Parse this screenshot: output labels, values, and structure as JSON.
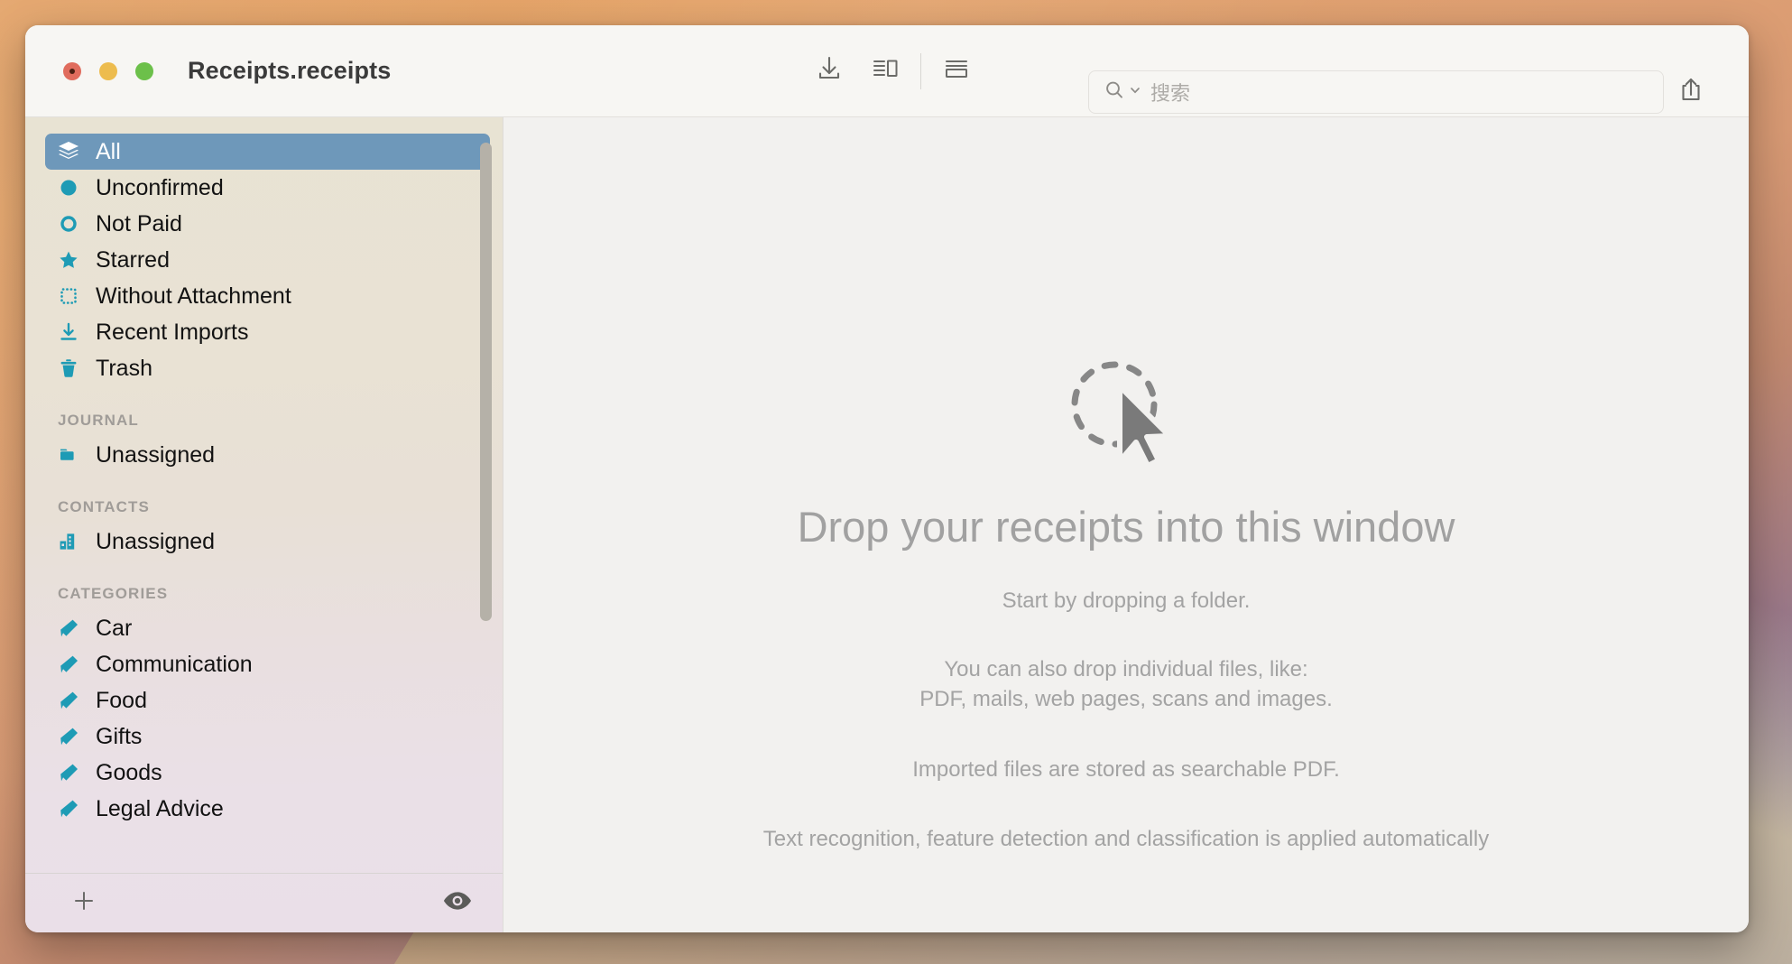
{
  "window": {
    "title": "Receipts.receipts",
    "traffic_lights": [
      "close",
      "minimize",
      "zoom"
    ]
  },
  "toolbar": {
    "import_icon": "download-icon",
    "sidebar_toggle_icon": "sidebar-split-view-icon",
    "list_view_icon": "list-view-icon",
    "share_icon": "share-icon",
    "search": {
      "icon": "search-icon",
      "chevron": "chevron-down-icon",
      "value": "",
      "placeholder": "搜索"
    }
  },
  "sidebar": {
    "smart_groups": [
      {
        "label": "All",
        "icon": "layers-stack-icon",
        "selected": true
      },
      {
        "label": "Unconfirmed",
        "icon": "filled-circle-icon",
        "selected": false
      },
      {
        "label": "Not Paid",
        "icon": "hollow-circle-icon",
        "selected": false
      },
      {
        "label": "Starred",
        "icon": "star-icon",
        "selected": false
      },
      {
        "label": "Without Attachment",
        "icon": "dotted-square-icon",
        "selected": false
      },
      {
        "label": "Recent Imports",
        "icon": "download-icon",
        "selected": false
      },
      {
        "label": "Trash",
        "icon": "trash-icon",
        "selected": false
      }
    ],
    "journal": {
      "header": "JOURNAL",
      "items": [
        {
          "label": "Unassigned",
          "icon": "folder-icon"
        }
      ]
    },
    "contacts": {
      "header": "CONTACTS",
      "items": [
        {
          "label": "Unassigned",
          "icon": "building-icon"
        }
      ]
    },
    "categories": {
      "header": "CATEGORIES",
      "items": [
        {
          "label": "Car",
          "icon": "tag-icon"
        },
        {
          "label": "Communication",
          "icon": "tag-icon"
        },
        {
          "label": "Food",
          "icon": "tag-icon"
        },
        {
          "label": "Gifts",
          "icon": "tag-icon"
        },
        {
          "label": "Goods",
          "icon": "tag-icon"
        },
        {
          "label": "Legal Advice",
          "icon": "tag-icon"
        }
      ]
    },
    "footer": {
      "add_icon": "plus-icon",
      "preview_icon": "eye-icon"
    }
  },
  "main": {
    "drop_icon": "cursor-drop-target-icon",
    "title": "Drop your receipts into this window",
    "line1": "Start by dropping a folder.",
    "line2a": "You can also drop individual files, like:",
    "line2b": "PDF, mails, web pages, scans and images.",
    "line3": "Imported files are stored as searchable PDF.",
    "line4": "Text recognition, feature detection and classification is applied automatically"
  },
  "colors": {
    "accent_teal": "#1e9bb5",
    "selection_blue": "#6e98ba",
    "titlebar_bg": "#f7f6f3",
    "content_bg": "#f2f1ef",
    "muted_text": "#a3a3a3"
  }
}
